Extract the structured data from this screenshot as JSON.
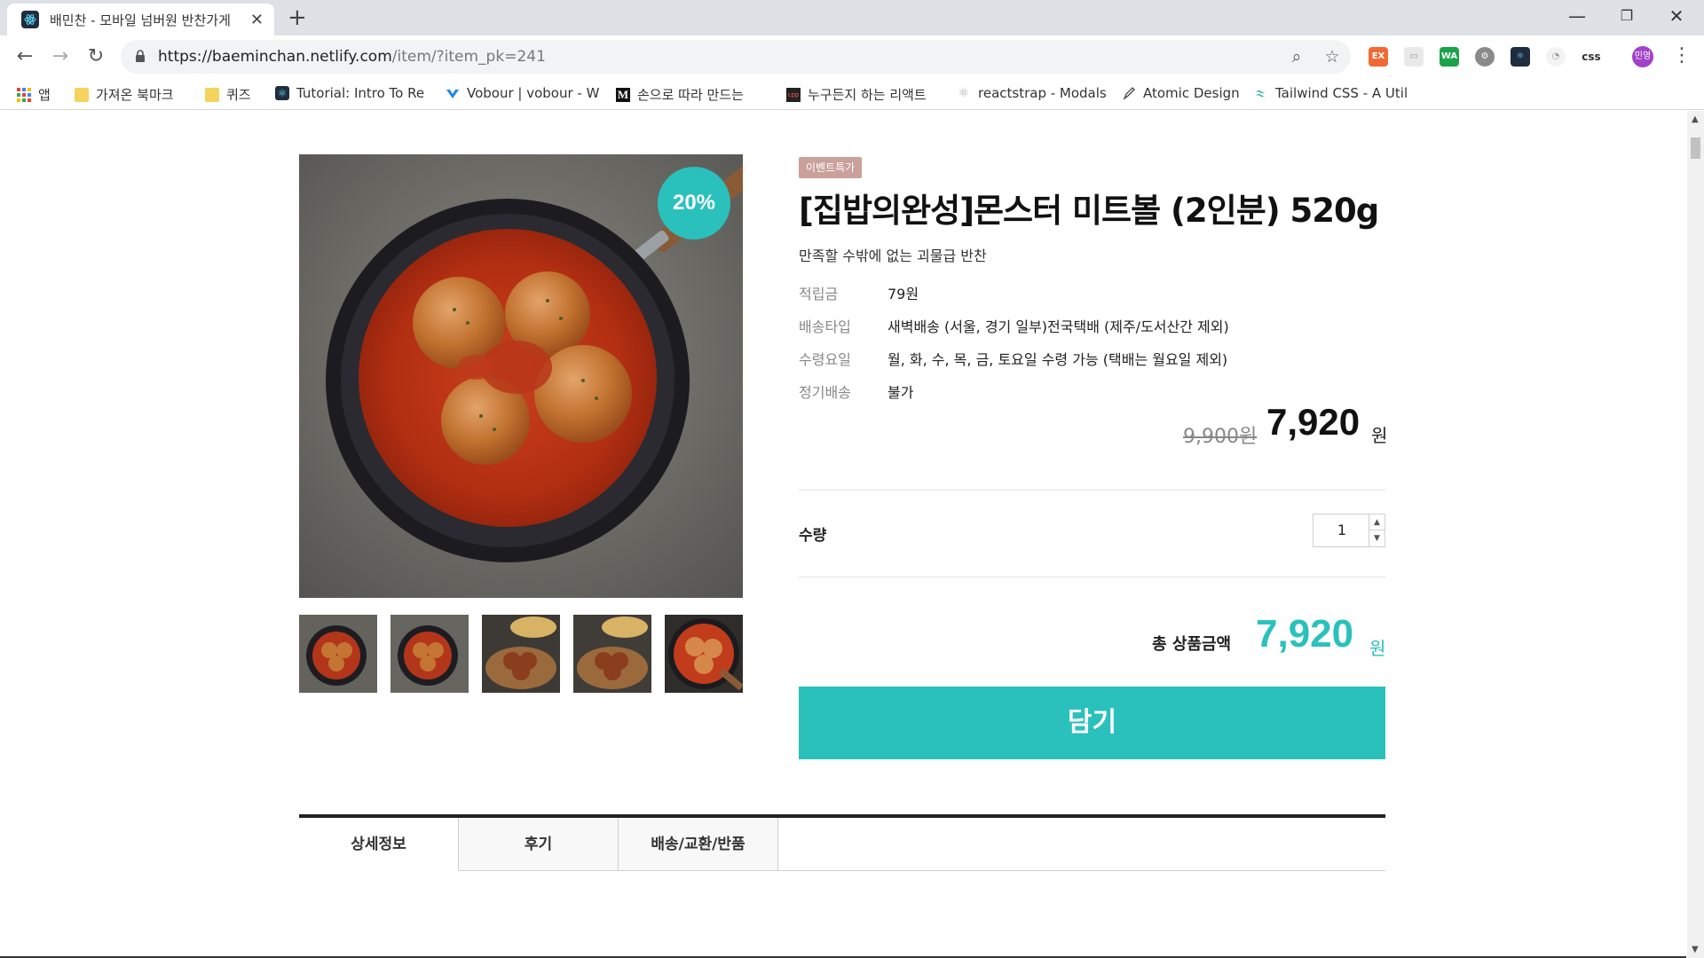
{
  "browser": {
    "tab_title": "배민찬 - 모바일 넘버원 반찬가게",
    "url_host": "https://baeminchan.netlify.com",
    "url_path": "/item/?item_pk=241",
    "profile_initials": "민영",
    "ext_labels": [
      "EX",
      "WA",
      "css"
    ]
  },
  "bookmarks": [
    {
      "label": "앱",
      "icon": "apps-grid-icon"
    },
    {
      "label": "가져온 북마크",
      "icon": "folder-icon"
    },
    {
      "label": "퀴즈",
      "icon": "folder-icon"
    },
    {
      "label": "Tutorial: Intro To Re",
      "icon": "react-icon"
    },
    {
      "label": "Vobour | vobour - W",
      "icon": "vobour-icon"
    },
    {
      "label": "손으로 따라 만드는 ",
      "icon": "medium-icon"
    },
    {
      "label": "누구든지 하는 리액트",
      "icon": "cpp-icon"
    },
    {
      "label": "reactstrap - Modals",
      "icon": "reactstrap-icon"
    },
    {
      "label": "Atomic Design",
      "icon": "pen-icon"
    },
    {
      "label": "Tailwind CSS - A Util",
      "icon": "tailwind-icon"
    }
  ],
  "product": {
    "discount_badge": "20%",
    "event_tag": "이벤트특가",
    "title": "[집밥의완성]몬스터 미트볼 (2인분) 520g",
    "description": "만족할 수밖에 없는 괴물급 반찬",
    "info": [
      {
        "key": "적립금",
        "value": "79원"
      },
      {
        "key": "배송타입",
        "value": "새벽배송 (서울, 경기 일부)전국택배 (제주/도서산간 제외)"
      },
      {
        "key": "수령요일",
        "value": "월, 화, 수, 목, 금, 토요일 수령 가능 (택배는 월요일 제외)"
      },
      {
        "key": "정기배송",
        "value": "불가"
      }
    ],
    "original_price": "9,900원",
    "sale_price": "7,920",
    "currency_unit": "원",
    "quantity_label": "수량",
    "quantity_value": "1",
    "total_label": "총 상품금액",
    "total_price": "7,920",
    "cart_button": "담기"
  },
  "detail_tabs": [
    "상세정보",
    "후기",
    "배송/교환/반품"
  ],
  "colors": {
    "accent": "#2ac1bc",
    "event_tag": "#c9a09b",
    "profile": "#a142c9"
  }
}
